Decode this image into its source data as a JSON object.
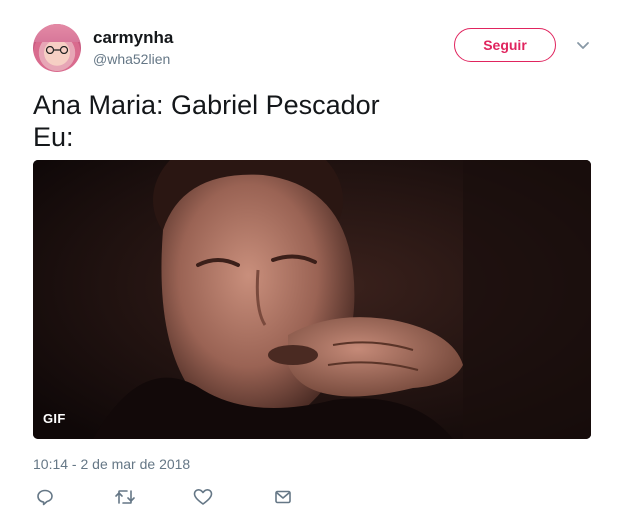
{
  "user": {
    "display_name": "carmynha",
    "handle": "@wha52lien"
  },
  "header": {
    "follow_label": "Seguir",
    "menu_icon": "chevron-down-icon"
  },
  "tweet": {
    "text": "Ana Maria: Gabriel Pescador\nEu:",
    "media_badge": "GIF",
    "timestamp": "10:14 - 2 de mar de 2018"
  },
  "actions": {
    "icons": [
      "reply-icon",
      "retweet-icon",
      "like-icon",
      "direct-message-icon"
    ]
  },
  "colors": {
    "accent": "#e0245e",
    "secondary_text": "#657786",
    "primary_text": "#14171a"
  }
}
